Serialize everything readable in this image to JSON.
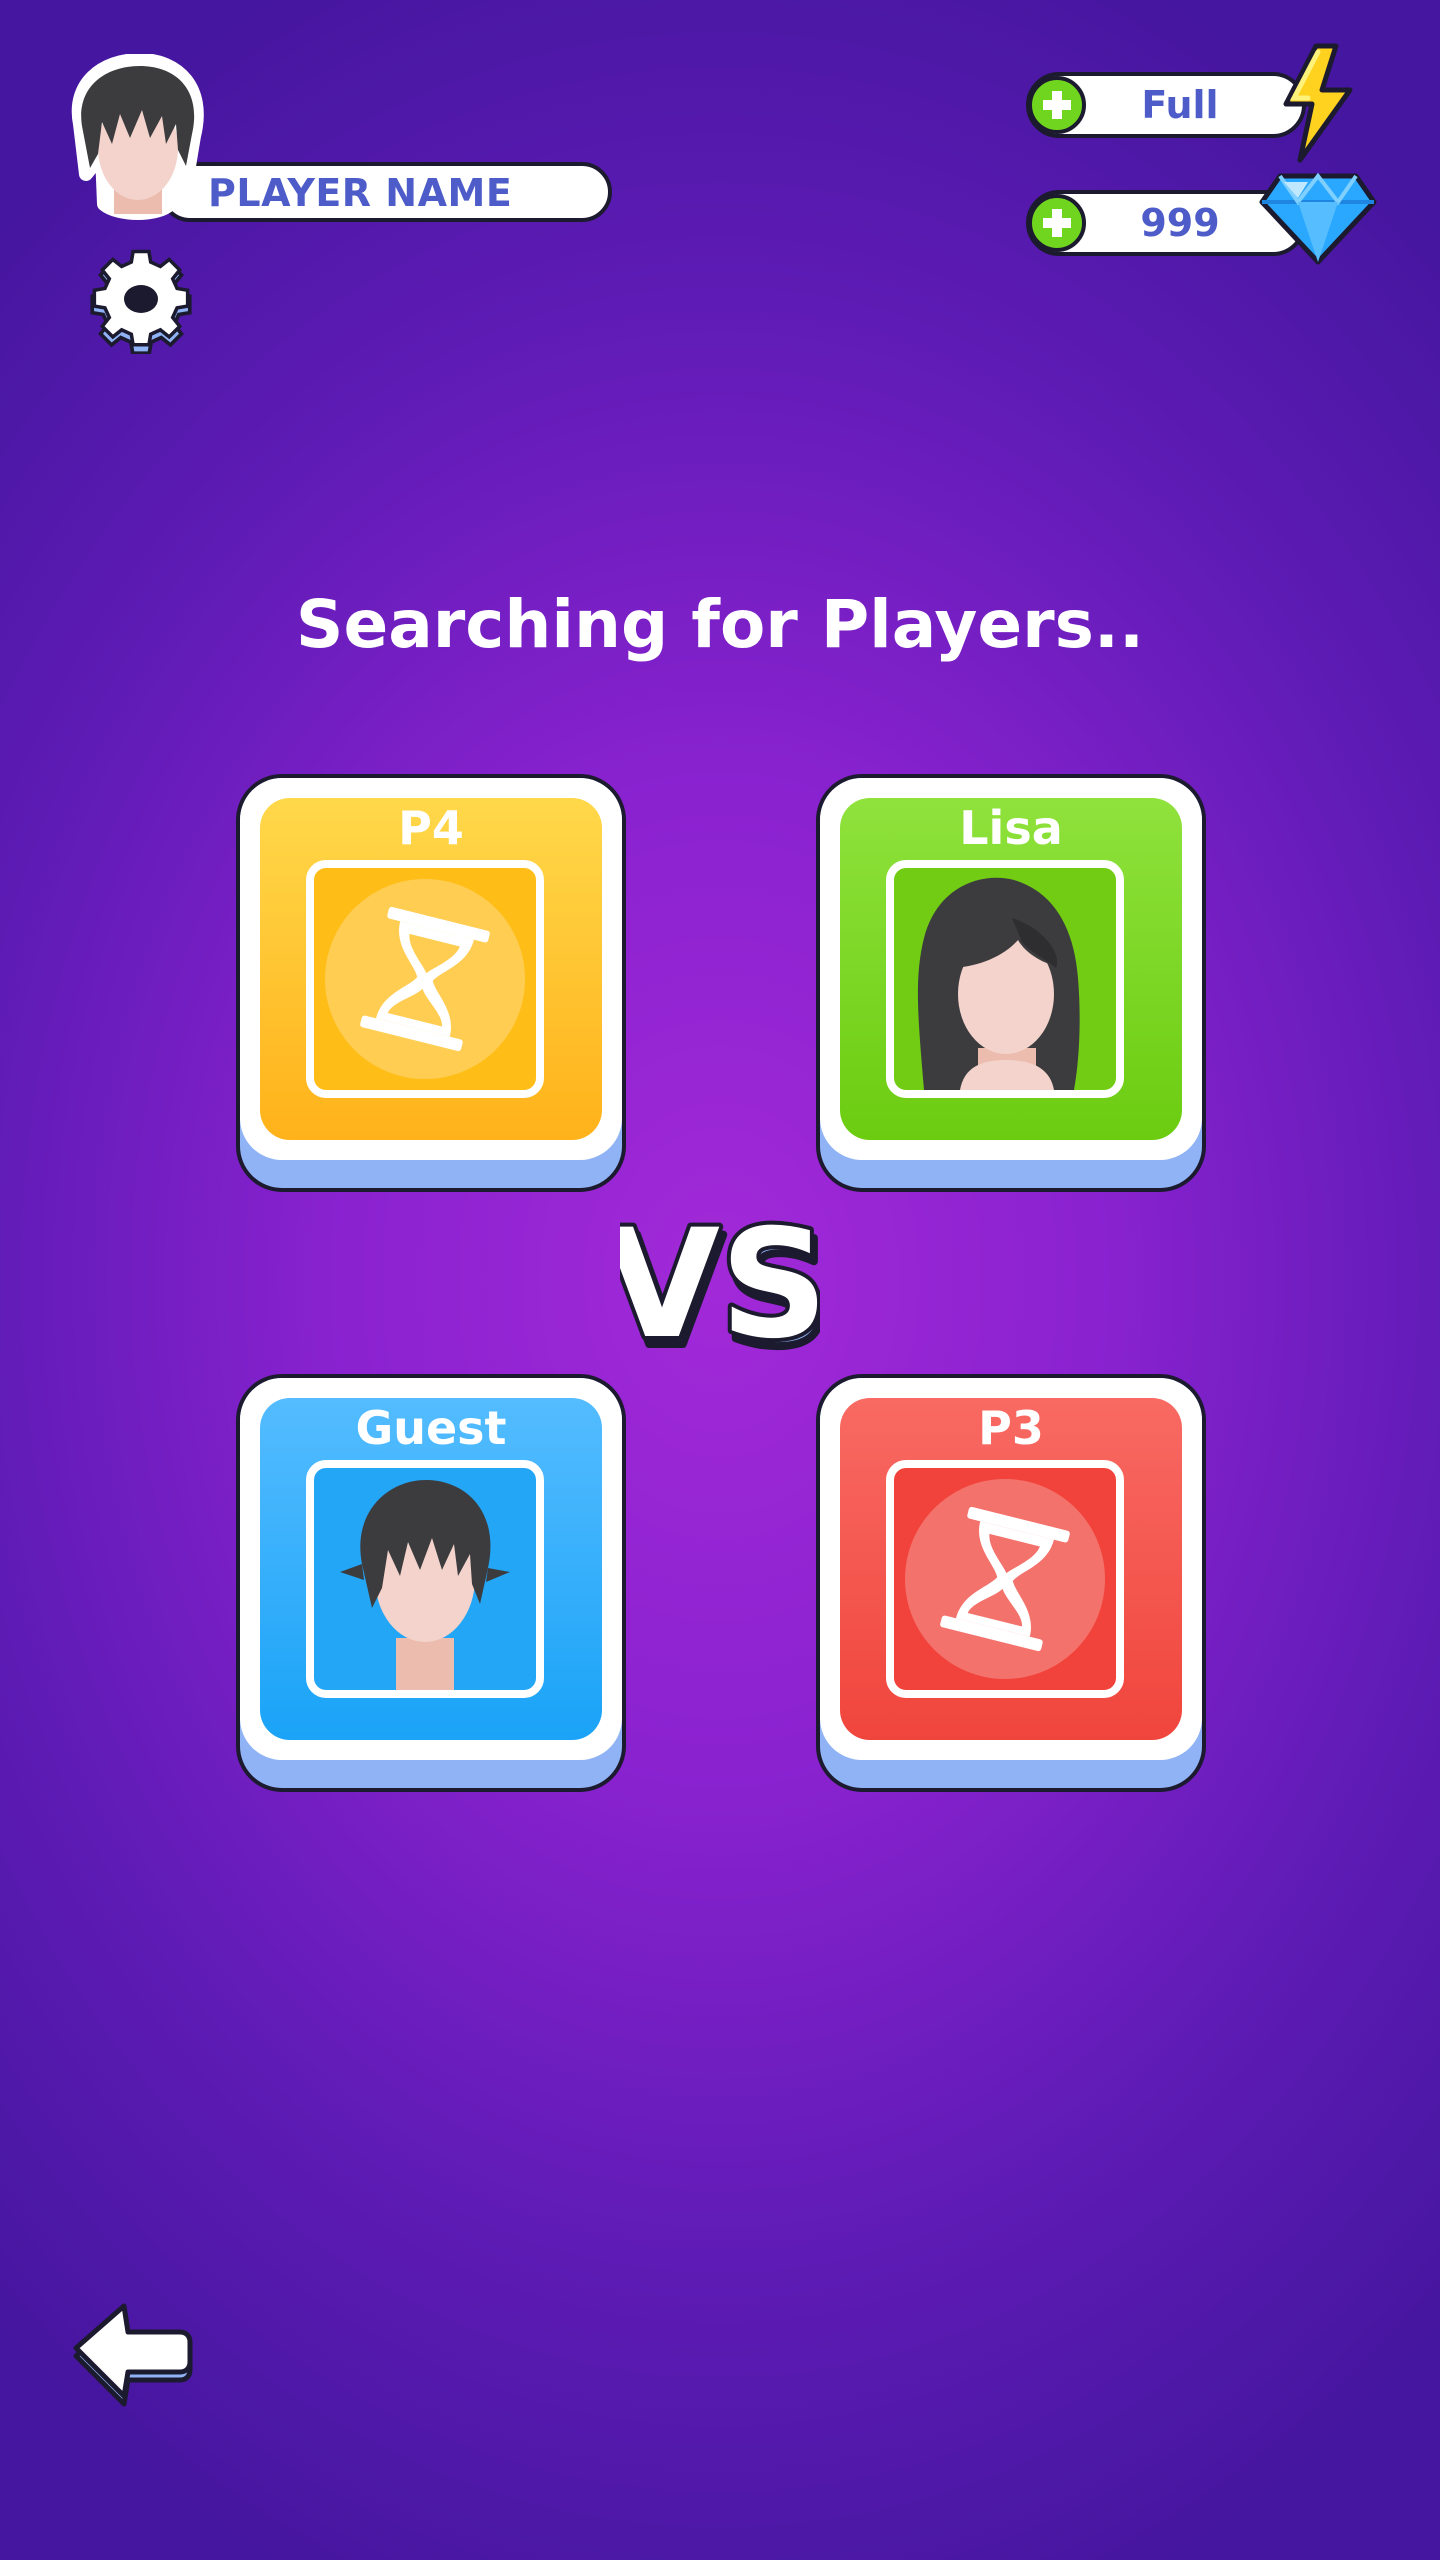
{
  "header": {
    "player_name": "PLAYER NAME"
  },
  "resources": {
    "energy": {
      "value": "Full",
      "icon": "lightning-icon"
    },
    "gems": {
      "value": "999",
      "icon": "gem-icon"
    }
  },
  "matchmaking": {
    "status_text": "Searching for Players..",
    "vs_text": "VS",
    "players": [
      {
        "label": "P4",
        "state": "waiting",
        "color": "#ffb21a",
        "icon": "hourglass-icon"
      },
      {
        "label": "Lisa",
        "state": "joined",
        "color": "#6bcc10",
        "icon": "female-avatar"
      },
      {
        "label": "Guest",
        "state": "joined",
        "color": "#1aa3f7",
        "icon": "male-avatar"
      },
      {
        "label": "P3",
        "state": "waiting",
        "color": "#f0453c",
        "icon": "hourglass-icon"
      }
    ]
  },
  "colors": {
    "background": "#8a22d0",
    "card_base": "#8fb3f5",
    "text_accent": "#4d5cc9",
    "plus_green": "#6fd51e",
    "lightning_yellow": "#ffd21f",
    "gem_blue": "#2aa8ff"
  }
}
